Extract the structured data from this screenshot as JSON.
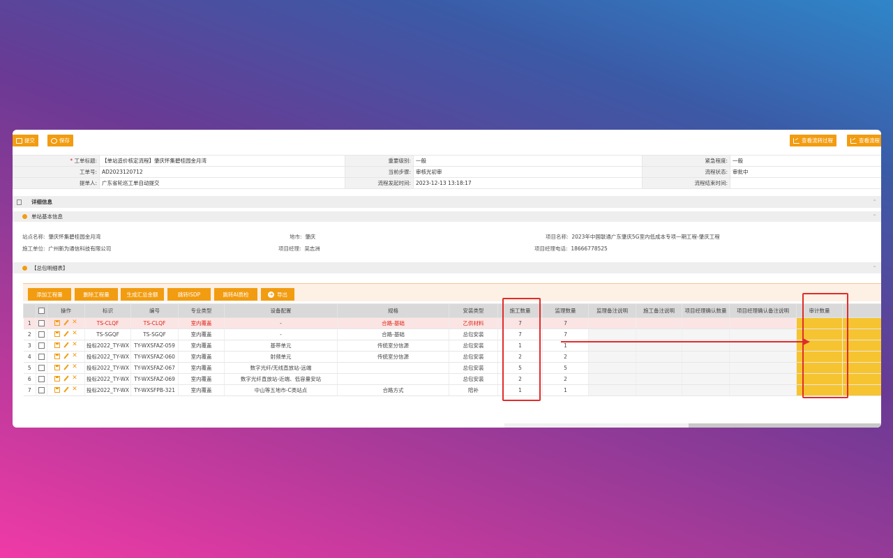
{
  "toolbar": {
    "submit_label": "提交",
    "save_label": "保存",
    "view_flow_label": "查看流转过程",
    "view_flow2_label": "查看流程"
  },
  "info": {
    "title_label": "工单标题:",
    "title_value": "【单站造价核定流程】肇庆怀集碧桂园金月湾",
    "level_label": "重要级别:",
    "level_value": "一般",
    "urgency_label": "紧急程度:",
    "urgency_value": "一般",
    "order_no_label": "工单号:",
    "order_no_value": "AD2023120712",
    "step_label": "当前步骤:",
    "step_value": "审核光初审",
    "status_label": "流程状态:",
    "status_value": "审批中",
    "submitter_label": "提单人:",
    "submitter_value": "广东省轮巡工单自动提交",
    "start_time_label": "流程发起时间:",
    "start_time_value": "2023-12-13 13:18:17",
    "end_time_label": "流程结束时间:",
    "end_time_value": ""
  },
  "detail_section": {
    "title": "详细信息"
  },
  "basic_section": {
    "title": "单站基本信息",
    "site_name_label": "站点名称:",
    "site_name_value": "肇庆怀集碧桂园金月湾",
    "city_label": "地市:",
    "city_value": "肇庆",
    "project_label": "项目名称:",
    "project_value": "2023年中国联通广东肇庆5G室内低成本专项一期工程-肇庆工程",
    "contractor_label": "施工单位:",
    "contractor_value": "广州新为通信科技有限公司",
    "pm_label": "项目经理:",
    "pm_value": "吴志洲",
    "pm_phone_label": "项目经理电话:",
    "pm_phone_value": "18666778525"
  },
  "package_section": {
    "title": "【总包明细表】"
  },
  "actions": {
    "add": "添加工程量",
    "delete": "删除工程量",
    "summary": "生成汇总金额",
    "isdp": "跳转ISDP",
    "ai": "跳转AI质检",
    "export": "导出"
  },
  "table": {
    "headers": [
      "",
      "",
      "操作",
      "标识",
      "编号",
      "专业类型",
      "设备配置",
      "规格",
      "安装类型",
      "施工数量",
      "监理数量",
      "监理备注说明",
      "施工备注说明",
      "项目经理确认数量",
      "项目经理确认备注说明",
      "审计数量"
    ],
    "rows": [
      {
        "n": "1",
        "id": "TS-CLQF",
        "code": "TS-CLQF",
        "type": "室内覆盖",
        "device": "-",
        "spec": "合路-基础",
        "install": "乙供材料",
        "qty": "7",
        "sup": "7"
      },
      {
        "n": "2",
        "id": "TS-SGQF",
        "code": "TS-SGQF",
        "type": "室内覆盖",
        "device": "-",
        "spec": "合路-基础",
        "install": "总包安装",
        "qty": "7",
        "sup": "7"
      },
      {
        "n": "3",
        "id": "投标2022_TY-WX",
        "code": "TY-WXSFAZ-059",
        "type": "室内覆盖",
        "device": "基带单元",
        "spec": "传统室分信源",
        "install": "总包安装",
        "qty": "1",
        "sup": "1"
      },
      {
        "n": "4",
        "id": "投标2022_TY-WX",
        "code": "TY-WXSFAZ-060",
        "type": "室内覆盖",
        "device": "射频单元",
        "spec": "传统室分信源",
        "install": "总包安装",
        "qty": "2",
        "sup": "2"
      },
      {
        "n": "5",
        "id": "投标2022_TY-WX",
        "code": "TY-WXSFAZ-067",
        "type": "室内覆盖",
        "device": "数字光纤/无线直放站-远端",
        "spec": "",
        "install": "总包安装",
        "qty": "5",
        "sup": "5"
      },
      {
        "n": "6",
        "id": "投标2022_TY-WX",
        "code": "TY-WXSFAZ-069",
        "type": "室内覆盖",
        "device": "数字光纤直放站-近端、低容量安站",
        "spec": "",
        "install": "总包安装",
        "qty": "2",
        "sup": "2"
      },
      {
        "n": "7",
        "id": "投标2022_TY-WX",
        "code": "TY-WXSFPB-321",
        "type": "室内覆盖",
        "device": "中山等五地市-C类站点",
        "spec": "合路方式",
        "install": "陪补",
        "qty": "1",
        "sup": "1"
      }
    ]
  },
  "colors": {
    "accent": "#f29c11",
    "highlight": "#f6c430",
    "annotation": "#e02b2b"
  }
}
